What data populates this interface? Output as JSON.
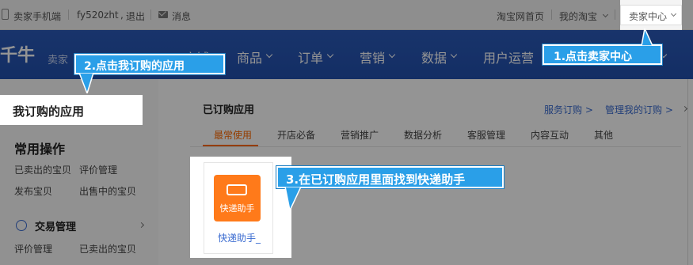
{
  "topbar": {
    "seller_mobile": "卖家手机端",
    "username": "fy520zht",
    "logout": "退出",
    "messages": "消息",
    "taobao_home": "淘宝网首页",
    "my_taobao": "我的淘宝",
    "seller_center": "卖家中心"
  },
  "navbar": {
    "logo": "千牛",
    "logo_sub": "卖家",
    "items": [
      "店铺",
      "商品",
      "订单",
      "营销",
      "数据",
      "用户运营"
    ]
  },
  "sidebar": {
    "active_tab": "我订购的应用",
    "common_ops_title": "常用操作",
    "common_links": [
      "已卖出的宝贝",
      "评价管理",
      "发布宝贝",
      "出售中的宝贝"
    ],
    "trade_title": "交易管理",
    "trade_links": [
      "评价管理",
      "已卖出的宝贝"
    ]
  },
  "content": {
    "title": "已订购应用",
    "service_order": "服务订购 >",
    "manage_orders": "管理我的订购 >",
    "tabs": [
      "最常使用",
      "开店必备",
      "营销推广",
      "数据分析",
      "客服管理",
      "内容互动",
      "其他"
    ],
    "app": {
      "icon_text": "快递助手",
      "name": "快递助手_"
    }
  },
  "callouts": {
    "step1": "1.点击卖家中心",
    "step2": "2.点击我订购的应用",
    "step3": "3.在已订购应用里面找到快递助手"
  },
  "colors": {
    "nav_blue": "#2250ad",
    "accent_orange": "#ff6a00",
    "callout_blue": "#2a9fe8",
    "link_blue": "#3a6bd0"
  }
}
